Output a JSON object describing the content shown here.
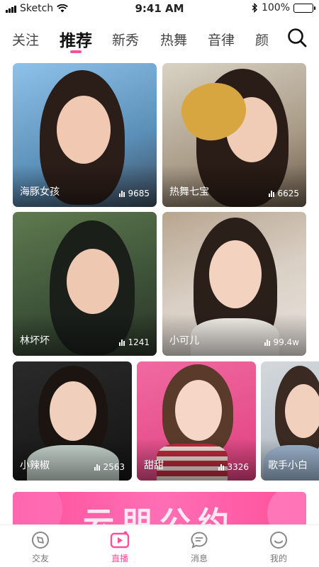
{
  "status_bar": {
    "carrier": "Sketch",
    "time": "9:41 AM",
    "battery": "100%"
  },
  "tabs": [
    {
      "label": "关注"
    },
    {
      "label": "推荐"
    },
    {
      "label": "新秀"
    },
    {
      "label": "热舞"
    },
    {
      "label": "音律"
    },
    {
      "label": "颜"
    }
  ],
  "active_tab": "推荐",
  "cards": [
    {
      "name": "海豚女孩",
      "count": "9685"
    },
    {
      "name": "热舞七宝",
      "count": "6625"
    },
    {
      "name": "林坏坏",
      "count": "1241"
    },
    {
      "name": "小可儿",
      "count": "99.4w"
    },
    {
      "name": "小辣椒",
      "count": "2563"
    },
    {
      "name": "甜甜",
      "count": "3326"
    },
    {
      "name": "歌手小白",
      "count": ""
    }
  ],
  "banner": {
    "text": "云朋公约"
  },
  "bottom_nav": [
    {
      "label": "交友",
      "icon": "compass-icon"
    },
    {
      "label": "直播",
      "icon": "live-video-icon"
    },
    {
      "label": "消息",
      "icon": "message-icon"
    },
    {
      "label": "我的",
      "icon": "profile-icon"
    }
  ],
  "colors": {
    "accent": "#ff4f9a"
  }
}
